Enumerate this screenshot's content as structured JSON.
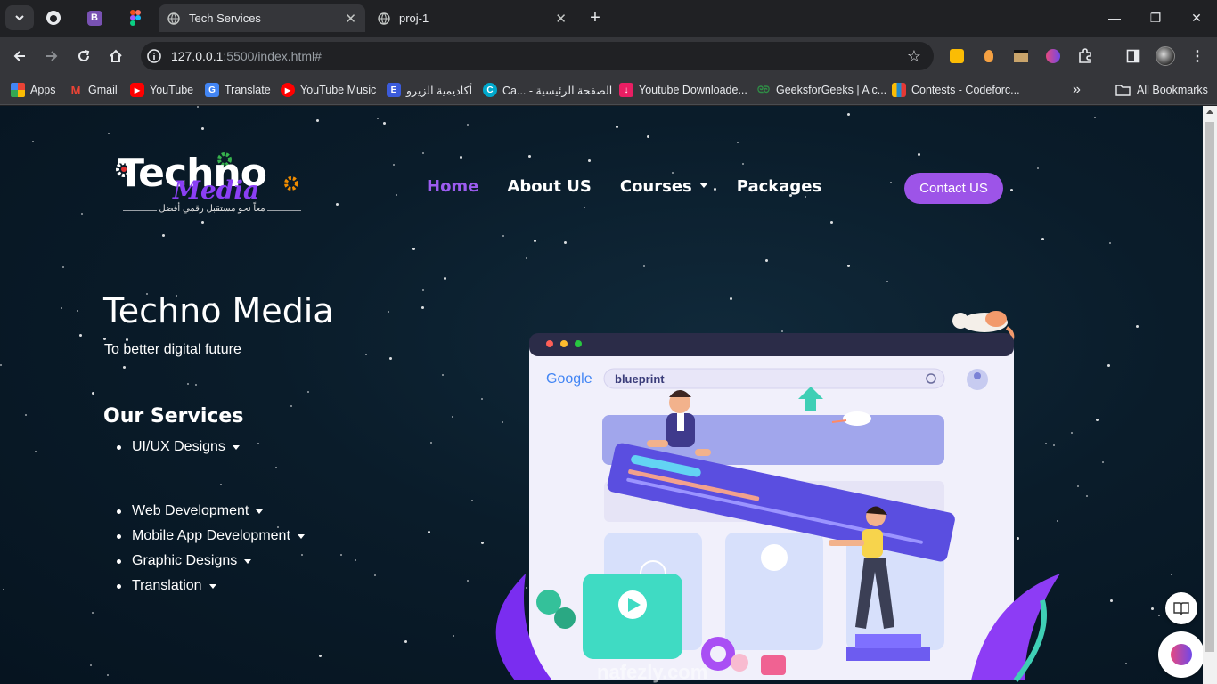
{
  "browser": {
    "tabs": [
      {
        "title": "Tech Services",
        "active": true
      },
      {
        "title": "proj-1",
        "active": false
      }
    ],
    "address": {
      "host": "127.0.0.1",
      "rest": ":5500/index.html#"
    },
    "bookmarks": [
      {
        "label": "Apps",
        "icon": "apps-grid-icon",
        "color": "#ea4335"
      },
      {
        "label": "Gmail",
        "icon": "gmail-icon",
        "color": "#ea4335"
      },
      {
        "label": "YouTube",
        "icon": "youtube-icon",
        "color": "#ff0000"
      },
      {
        "label": "Translate",
        "icon": "translate-icon",
        "color": "#4285f4"
      },
      {
        "label": "YouTube Music",
        "icon": "youtube-music-icon",
        "color": "#ff0000"
      },
      {
        "label": "أكاديمية الزيرو",
        "icon": "e-letter-icon",
        "color": "#3b5bdb"
      },
      {
        "label": "Ca... - الصفحة الرئيسية",
        "icon": "canva-icon",
        "color": "#00c4cc"
      },
      {
        "label": "Youtube Downloade...",
        "icon": "download-icon",
        "color": "#e91e63"
      },
      {
        "label": "GeeksforGeeks | A c...",
        "icon": "gfg-icon",
        "color": "#2f8d46"
      },
      {
        "label": "Contests - Codeforc...",
        "icon": "codeforces-icon",
        "color": "#1f8acb"
      }
    ],
    "all_bookmarks": "All Bookmarks"
  },
  "site": {
    "logo": {
      "word1": "Techno",
      "word2": "Media",
      "tagline": "معاً نحو مستقبل رقمي أفضل"
    },
    "nav": {
      "home": "Home",
      "about": "About US",
      "courses": "Courses",
      "packages": "Packages"
    },
    "contact_button": "Contact US",
    "hero": {
      "title": "Techno Media",
      "subtitle": "To better digital future"
    },
    "services": {
      "title": "Our Services",
      "items": [
        "UI/UX Designs",
        "Web Development",
        "Mobile App Development",
        "Graphic Designs",
        "Translation"
      ]
    },
    "illustration": {
      "search_brand": "Google",
      "search_query": "blueprint",
      "watermark": "nafezly.com"
    }
  },
  "colors": {
    "accent": "#9d54e8",
    "page_bg": "#0a1c2a"
  }
}
